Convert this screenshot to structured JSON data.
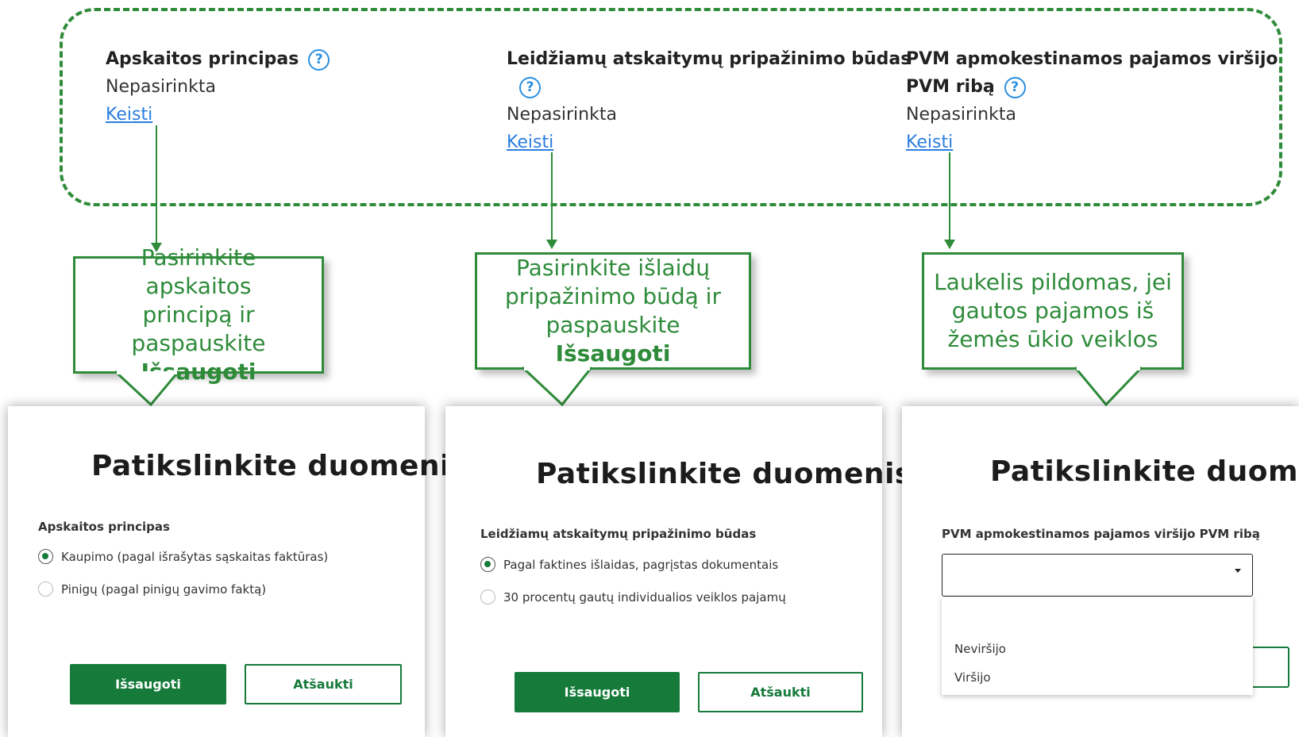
{
  "fields": [
    {
      "title": "Apskaitos principas",
      "value": "Nepasirinkta",
      "link": "Keisti"
    },
    {
      "title_line1": "Leidžiamų atskaitymų pripažinimo būdas",
      "value": "Nepasirinkta",
      "link": "Keisti"
    },
    {
      "title_line1": "PVM apmokestinamos pajamos viršijo",
      "title_line2": "PVM ribą",
      "value": "Nepasirinkta",
      "link": "Keisti"
    }
  ],
  "help_icon_glyph": "?",
  "callouts": [
    {
      "line1": "Pasirinkite apskaitos",
      "line2": "principą ir",
      "line3_prefix": "paspauskite ",
      "line3_bold": "Išsaugoti"
    },
    {
      "line1": "Pasirinkite išlaidų",
      "line2": "pripažinimo būdą ir",
      "line3_prefix": "paspauskite ",
      "line3_bold": "Išsaugoti"
    },
    {
      "line1": "Laukelis pildomas, jei",
      "line2": "gautos pajamos iš",
      "line3": "žemės ūkio veiklos"
    }
  ],
  "dialogs": [
    {
      "title": "Patikslinkite duomenis",
      "label": "Apskaitos principas",
      "options": [
        "Kaupimo (pagal išrašytas sąskaitas faktūras)",
        "Pinigų (pagal pinigų gavimo faktą)"
      ],
      "selected_option": "Kaupimo (pagal išrašytas sąskaitas faktūras)",
      "save": "Išsaugoti",
      "cancel": "Atšaukti"
    },
    {
      "title": "Patikslinkite duomenis",
      "label": "Leidžiamų atskaitymų pripažinimo būdas",
      "options": [
        "Pagal faktines išlaidas, pagrįstas dokumentais",
        "30 procentų gautų individualios veiklos pajamų"
      ],
      "selected_option": "Pagal faktines išlaidas, pagrįstas dokumentais",
      "save": "Išsaugoti",
      "cancel": "Atšaukti"
    },
    {
      "title": "Patikslinkite duomenis",
      "label": "PVM apmokestinamos pajamos viršijo PVM ribą",
      "select_value": "",
      "dropdown_options": [
        "Neviršijo",
        "Viršijo"
      ]
    }
  ],
  "colors": {
    "accent_green": "#157a3a",
    "callout_green": "#2e8b3a",
    "link_blue": "#2a7de1"
  }
}
